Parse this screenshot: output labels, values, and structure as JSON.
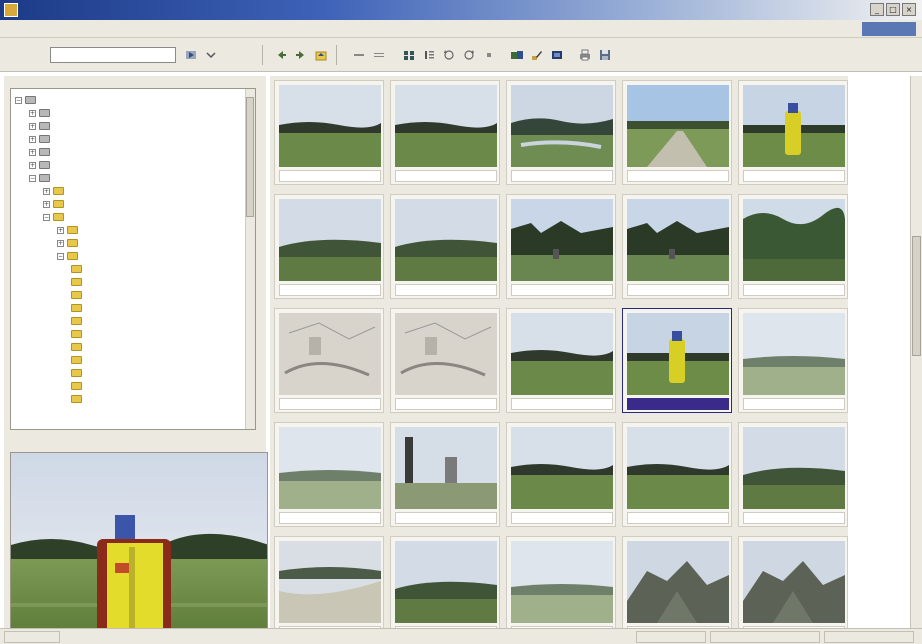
{
  "window": {
    "title": "",
    "controls": [
      "_",
      "□",
      "×"
    ]
  },
  "menubar": {
    "items": [
      "",
      "",
      "",
      "",
      "",
      "",
      "",
      ""
    ]
  },
  "toolbar": {
    "address_label": "",
    "address_value": ""
  },
  "tree": {
    "items": [
      {
        "label": ""
      },
      {
        "label": ""
      },
      {
        "label": ""
      },
      {
        "label": ""
      },
      {
        "label": ""
      },
      {
        "label": ""
      },
      {
        "label": ""
      },
      {
        "label": ""
      },
      {
        "label": ""
      },
      {
        "label": ""
      },
      {
        "label": ""
      },
      {
        "label": ""
      },
      {
        "label": ""
      },
      {
        "label": ""
      },
      {
        "label": ""
      },
      {
        "label": ""
      },
      {
        "label": ""
      },
      {
        "label": ""
      },
      {
        "label": ""
      },
      {
        "label": ""
      },
      {
        "label": ""
      },
      {
        "label": ""
      },
      {
        "label": ""
      },
      {
        "label": ""
      }
    ]
  },
  "preview": {
    "header": "",
    "caption_line1": "",
    "caption_line2": ""
  },
  "gallery": {
    "selected_index": 13,
    "thumbnails": [
      {
        "label": "",
        "scene": "field"
      },
      {
        "label": "",
        "scene": "field"
      },
      {
        "label": "",
        "scene": "river"
      },
      {
        "label": "",
        "scene": "road"
      },
      {
        "label": "",
        "scene": "person"
      },
      {
        "label": "",
        "scene": "hills"
      },
      {
        "label": "",
        "scene": "hills"
      },
      {
        "label": "",
        "scene": "trees"
      },
      {
        "label": "",
        "scene": "trees"
      },
      {
        "label": "",
        "scene": "forest"
      },
      {
        "label": "",
        "scene": "sketch"
      },
      {
        "label": "",
        "scene": "sketch"
      },
      {
        "label": "",
        "scene": "field"
      },
      {
        "label": "",
        "scene": "person"
      },
      {
        "label": "",
        "scene": "hazy"
      },
      {
        "label": "",
        "scene": "hazy"
      },
      {
        "label": "",
        "scene": "tower"
      },
      {
        "label": "",
        "scene": "field"
      },
      {
        "label": "",
        "scene": "field"
      },
      {
        "label": "",
        "scene": "hills"
      },
      {
        "label": "",
        "scene": "dunes"
      },
      {
        "label": "",
        "scene": "hills"
      },
      {
        "label": "",
        "scene": "hazy"
      },
      {
        "label": "",
        "scene": "rocks"
      },
      {
        "label": "",
        "scene": "rocks"
      }
    ]
  },
  "statusbar": {
    "left": "",
    "middle": "",
    "right1": "",
    "right2": ""
  },
  "colors": {
    "chrome": "#ece9e1",
    "title_dark": "#1c3a86",
    "selection": "#3a2a8a",
    "folder": "#e8c84a"
  }
}
